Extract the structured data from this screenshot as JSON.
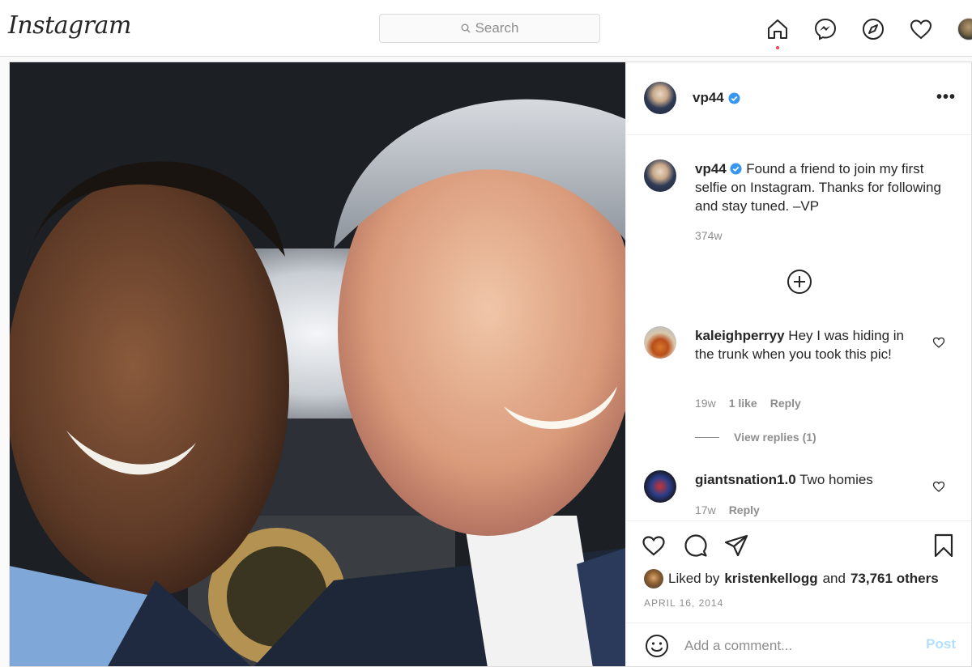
{
  "nav": {
    "logo": "Instagram",
    "search_placeholder": "Search",
    "icons": [
      "home-icon",
      "messenger-icon",
      "explore-icon",
      "activity-heart-icon",
      "profile-avatar"
    ]
  },
  "post": {
    "username": "vp44",
    "more": "•••",
    "caption_user": "vp44",
    "caption_text": "Found a friend to join my first selfie on Instagram. Thanks for following and stay tuned. –VP",
    "caption_time": "374w",
    "comments": [
      {
        "user": "kaleighperryy",
        "text": "Hey I was hiding in the trunk when you took this pic!",
        "time": "19w",
        "likes": "1 like",
        "reply": "Reply",
        "view_replies": "View replies (1)"
      },
      {
        "user": "giantsnation1.0",
        "text": "Two homies",
        "time": "17w",
        "reply": "Reply"
      }
    ],
    "liked_by_prefix": "Liked by",
    "liked_by_user": "kristenkellogg",
    "liked_by_and": "and",
    "liked_by_others": "73,761 others",
    "date": "APRIL 16, 2014",
    "add_comment_placeholder": "Add a comment...",
    "post_button": "Post"
  },
  "colors": {
    "verified": "#3897f0",
    "notification_dot": "#ed4956",
    "post_button_disabled": "#b2dffc",
    "muted_text": "#8e8e8e"
  }
}
